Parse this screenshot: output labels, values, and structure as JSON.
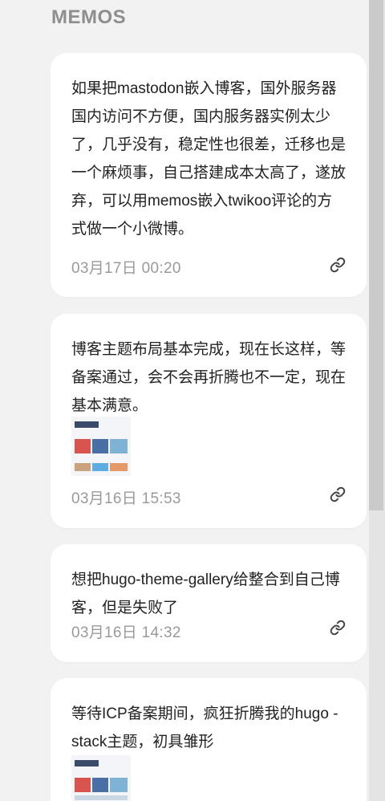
{
  "section": {
    "title": "MEMOS"
  },
  "memos": [
    {
      "text": "如果把mastodon嵌入博客，国外服务器国内访问不方便，国内服务器实例太少了，几乎没有，稳定性也很差，迁移也是一个麻烦事，自己搭建成本太高了，遂放弃，可以用memos嵌入twikoo评论的方式做一个小微博。",
      "date": "03月17日 00:20",
      "has_image": false
    },
    {
      "text": "博客主题布局基本完成，现在长这样，等备案通过，会不会再折腾也不一定，现在基本满意。",
      "date": "03月16日 15:53",
      "has_image": true
    },
    {
      "text": "想把hugo-theme-gallery给整合到自己博客，但是失败了",
      "date": "03月16日 14:32",
      "has_image": false
    },
    {
      "text": "等待ICP备案期间，疯狂折腾我的hugo - stack主题，初具雏形",
      "date": "",
      "has_image": true
    }
  ],
  "icons": {
    "permalink": "link-icon"
  }
}
